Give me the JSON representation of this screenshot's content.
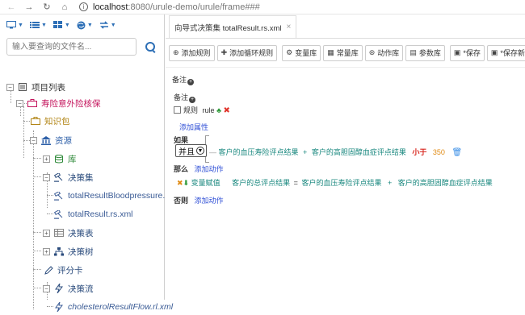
{
  "browser": {
    "url_host": "localhost",
    "url_path": ":8080/urule-demo/urule/frame###"
  },
  "left_toolbar": {
    "icons": [
      "monitor-icon",
      "list-icon",
      "grid-icon",
      "globe-icon",
      "refresh-icon"
    ]
  },
  "search": {
    "placeholder": "输入要查询的文件名..."
  },
  "tree": {
    "project_list": "项目列表",
    "project": "寿险意外险核保",
    "knowledge": "知识包",
    "resources": "资源",
    "library": "库",
    "decision_set": "决策集",
    "file1": "totalResultBloodpressure.rs.xml",
    "file2": "totalResult.rs.xml",
    "decision_table": "决策表",
    "decision_tree": "决策树",
    "scorecard": "评分卡",
    "decision_flow": "决策流",
    "file3": "cholesterolResultFlow.rl.xml"
  },
  "tab": {
    "label": "向导式决策集 totalResult.rs.xml",
    "close": "×"
  },
  "actions": {
    "add_rule": "添加规则",
    "add_loop_rule": "添加循环规则",
    "variable_lib": "变量库",
    "constant_lib": "常量库",
    "action_lib": "动作库",
    "param_lib": "参数库",
    "save": "*保存",
    "save_new_version": "*保存新版本"
  },
  "editor": {
    "remark_top": "备注",
    "remark": "备注",
    "rule_label": "规则",
    "rule_name": "rule",
    "add_property": "添加属性",
    "if_label": "如果",
    "junction": "并且",
    "cond_left1": "客户的血压寿险评点结果",
    "plus": "+",
    "cond_left2": "客户的高胆固醇血症评点结果",
    "operator": "小于",
    "cond_value": "350",
    "then_label": "那么",
    "add_action": "添加动作",
    "assign_label": "变量赋值",
    "assign_target": "客户的总评点结果",
    "equals": "=",
    "assign_src1": "客户的血压寿险评点结果",
    "assign_src2": "客户的高胆固醇血症评点结果",
    "else_label": "否则",
    "add_action_else": "添加动作"
  },
  "colors": {
    "link": "#2f4fd6",
    "teal": "#18877e",
    "orange": "#e08a12",
    "red": "#d8261e",
    "project": "#c4155d"
  }
}
